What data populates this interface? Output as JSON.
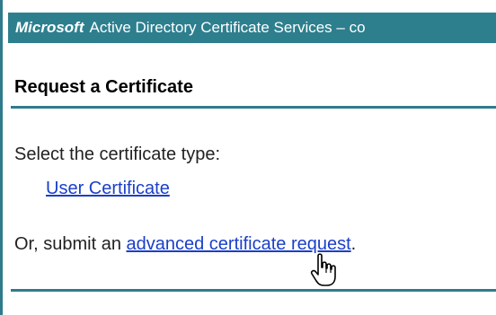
{
  "banner": {
    "brand": "Microsoft",
    "title": "Active Directory Certificate Services  –  co"
  },
  "page": {
    "title": "Request a Certificate",
    "prompt": "Select the certificate type:",
    "user_certificate_link": "User Certificate",
    "submit_prefix": "Or, submit an ",
    "advanced_request_link": "advanced certificate request",
    "submit_suffix": "."
  },
  "colors": {
    "banner_bg": "#2d7f8e",
    "rule": "#2f7b8c",
    "link": "#1a3fc9"
  },
  "icons": {
    "cursor": "hand-pointer-icon"
  }
}
